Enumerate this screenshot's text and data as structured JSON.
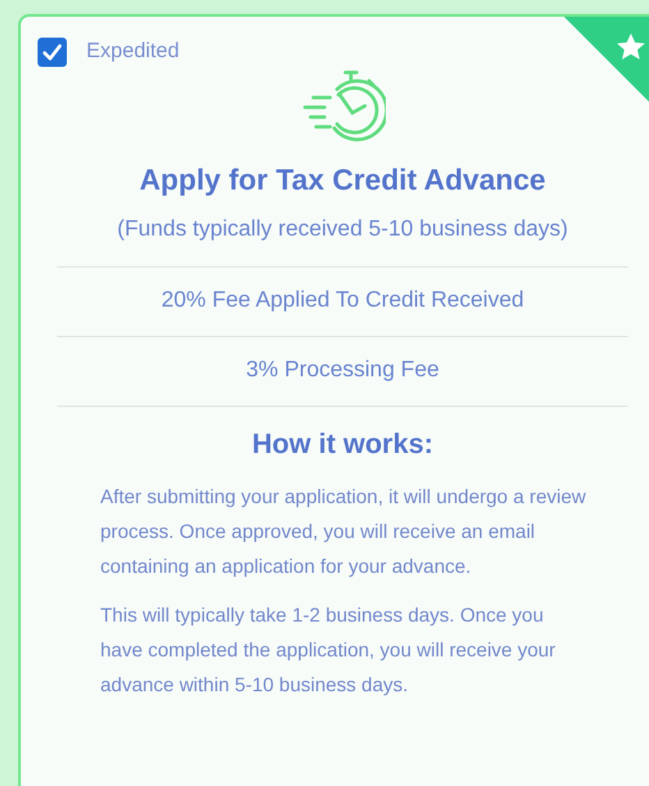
{
  "option": {
    "label": "Expedited",
    "checked": true
  },
  "featured": true,
  "title": "Apply for Tax Credit Advance",
  "subtitle": "(Funds typically received 5-10 business days)",
  "fees": [
    "20% Fee Applied To Credit Received",
    "3% Processing Fee"
  ],
  "how_it_works": {
    "heading": "How it works:",
    "paragraphs": [
      "After submitting your application, it will undergo a review process. Once approved, you will receive an email containing an application for your advance.",
      "This will typically take 1-2 business days. Once you have completed the application, you will receive your advance within 5-10 business days."
    ]
  }
}
